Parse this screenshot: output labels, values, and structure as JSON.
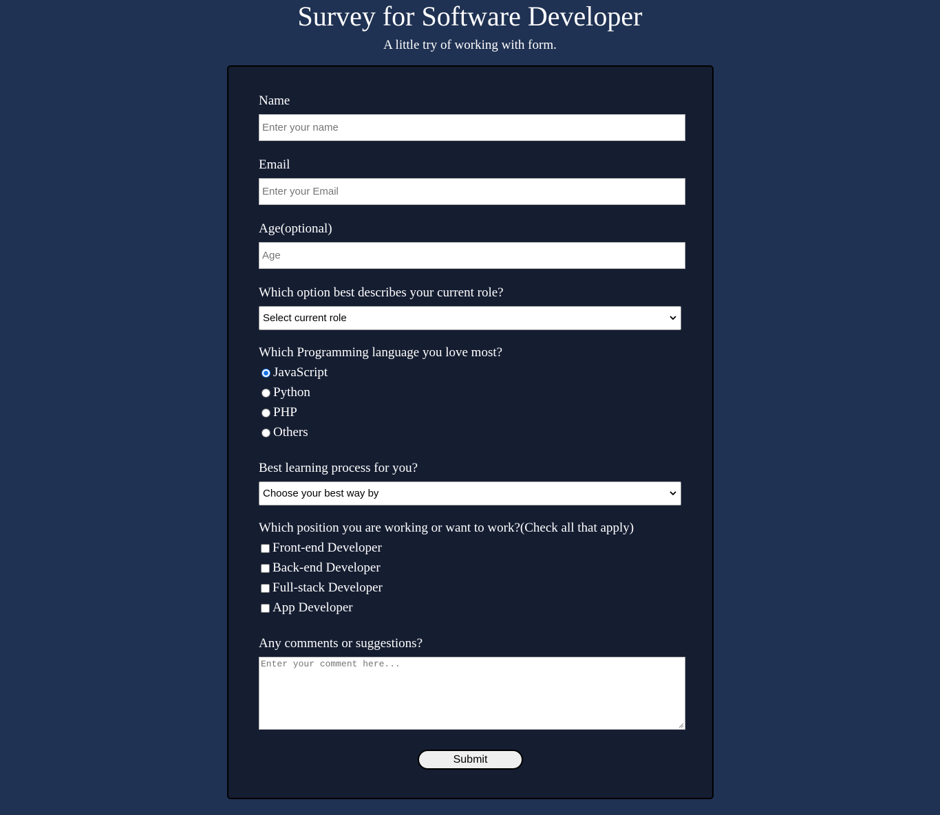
{
  "header": {
    "title": "Survey for Software Developer",
    "subtitle": "A little try of working with form."
  },
  "form": {
    "name": {
      "label": "Name",
      "placeholder": "Enter your name",
      "value": ""
    },
    "email": {
      "label": "Email",
      "placeholder": "Enter your Email",
      "value": ""
    },
    "age": {
      "label": "Age(optional)",
      "placeholder": "Age",
      "value": ""
    },
    "role": {
      "label": "Which option best describes your current role?",
      "selected": "Select current role"
    },
    "language": {
      "label": "Which Programming language you love most?",
      "options": [
        "JavaScript",
        "Python",
        "PHP",
        "Others"
      ],
      "selected": "JavaScript"
    },
    "learning": {
      "label": "Best learning process for you?",
      "selected": "Choose your best way by"
    },
    "positions": {
      "label": "Which position you are working or want to work?(Check all that apply)",
      "options": [
        "Front-end Developer",
        "Back-end Developer",
        "Full-stack Developer",
        "App Developer"
      ],
      "checked": []
    },
    "comments": {
      "label": "Any comments or suggestions?",
      "placeholder": "Enter your comment here..."
    },
    "submit_label": "Submit"
  },
  "colors": {
    "page_background": "#203253",
    "card_background": "#151d31",
    "radio_accent": "#1a73e8"
  },
  "icons": [
    "chevron-down-icon",
    "resize-handle-icon"
  ]
}
